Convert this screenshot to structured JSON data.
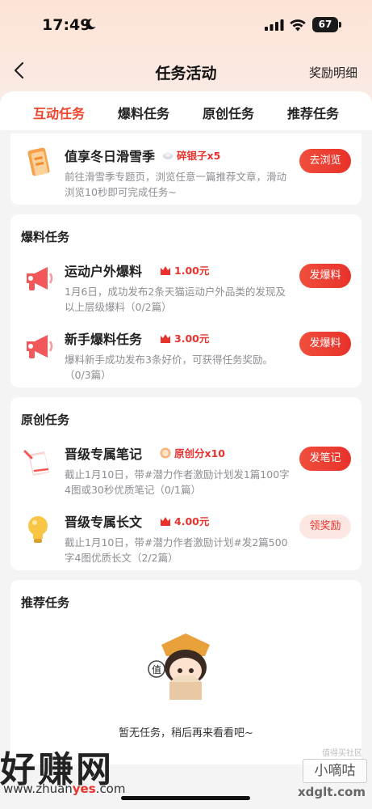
{
  "status_bar": {
    "time": "17:49",
    "battery": "67"
  },
  "header": {
    "title": "任务活动",
    "right_link": "奖励明细"
  },
  "tabs": [
    {
      "label": "互动任务",
      "active": true
    },
    {
      "label": "爆料任务",
      "active": false
    },
    {
      "label": "原创任务",
      "active": false
    },
    {
      "label": "推荐任务",
      "active": false
    }
  ],
  "interactive": {
    "task": {
      "name": "值享冬日滑雪季",
      "reward": "碎银子x5",
      "desc": "前往滑雪季专题页，浏览任意一篇推荐文章，滑动浏览10秒即可完成任务~",
      "button": "去浏览",
      "icon": "ski-card-icon"
    }
  },
  "baoliao": {
    "title": "爆料任务",
    "tasks": [
      {
        "name": "运动户外爆料",
        "reward": "1.00元",
        "desc": "1月6日，成功发布2条天猫运动户外品类的发现及以上层级爆料（0/2篇）",
        "button": "发爆料",
        "icon": "megaphone-icon"
      },
      {
        "name": "新手爆料任务",
        "reward": "3.00元",
        "desc": "爆料新手成功发布3条好价，可获得任务奖励。（0/3篇）",
        "button": "发爆料",
        "icon": "megaphone-icon"
      }
    ]
  },
  "yuanchuang": {
    "title": "原创任务",
    "tasks": [
      {
        "name": "晋级专属笔记",
        "reward": "原创分x10",
        "desc": "截止1月10日，带#潜力作者激励计划发1篇100字4图或30秒优质笔记（0/1篇）",
        "button": "发笔记",
        "icon": "note-icon"
      },
      {
        "name": "晋级专属长文",
        "reward": "4.00元",
        "desc": "截止1月10日，带#潜力作者激励计划#发2篇500字4图优质长文（2/2篇）",
        "button": "领奖励",
        "icon": "lightbulb-icon"
      }
    ]
  },
  "tuijian": {
    "title": "推荐任务",
    "empty_text": "暂无任务，稍后再来看看吧~",
    "mascot_sign": "值"
  },
  "watermarks": {
    "left_brand": "好赚网",
    "left_url_prefix": "www.zhuan",
    "left_url_highlight": "yes",
    "left_url_suffix": ".com",
    "right_top": "值得买社区",
    "right_brand": "小嘀咕",
    "right_url": "xdglt.com"
  },
  "colors": {
    "accent": "#e8322b",
    "header_bg": "#fde3d6",
    "page_bg": "#f4f4f5"
  }
}
